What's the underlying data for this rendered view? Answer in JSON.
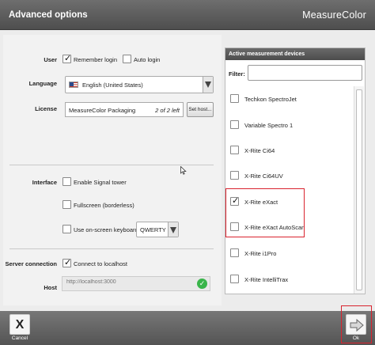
{
  "header": {
    "title": "Advanced options",
    "brand": "MeasureColor"
  },
  "user": {
    "label": "User",
    "remember_login": "Remember login",
    "remember_checked": true,
    "auto_login": "Auto login",
    "auto_checked": false
  },
  "language": {
    "label": "Language",
    "value": "English (United States)",
    "flag_icon": "us-flag-icon"
  },
  "license": {
    "label": "License",
    "value": "MeasureColor Packaging",
    "count": "2 of 2 left",
    "set_host": "Set host..."
  },
  "interface": {
    "label": "Interface",
    "signal_tower": "Enable Signal tower",
    "signal_checked": false,
    "fullscreen": "Fullscreen (borderless)",
    "fullscreen_checked": false,
    "onscreen_keyboard": "Use on-screen keyboard",
    "keyboard_checked": false,
    "keyboard_layout": "QWERTY"
  },
  "server": {
    "label": "Server connection",
    "connect_localhost": "Connect to localhost",
    "connect_checked": true,
    "host_label": "Host",
    "host_placeholder": "http://localhost:3000"
  },
  "devices": {
    "title": "Active measurement devices",
    "filter_label": "Filter:",
    "filter_value": "",
    "items": [
      {
        "label": "Techkon SpectroJet",
        "checked": false
      },
      {
        "label": "Variable Spectro 1",
        "checked": false
      },
      {
        "label": "X-Rite Ci64",
        "checked": false
      },
      {
        "label": "X-Rite Ci64UV",
        "checked": false
      },
      {
        "label": "X-Rite eXact",
        "checked": true
      },
      {
        "label": "X-Rite eXact AutoScan",
        "checked": false
      },
      {
        "label": "X-Rite i1Pro",
        "checked": false
      },
      {
        "label": "X-Rite IntelliTrax",
        "checked": false
      }
    ]
  },
  "footer": {
    "cancel_label": "Cancel",
    "ok_label": "Ok"
  },
  "colors": {
    "highlight": "#d9232e",
    "header_bg": "#5e5e5e",
    "ok_check": "#39b54a"
  }
}
